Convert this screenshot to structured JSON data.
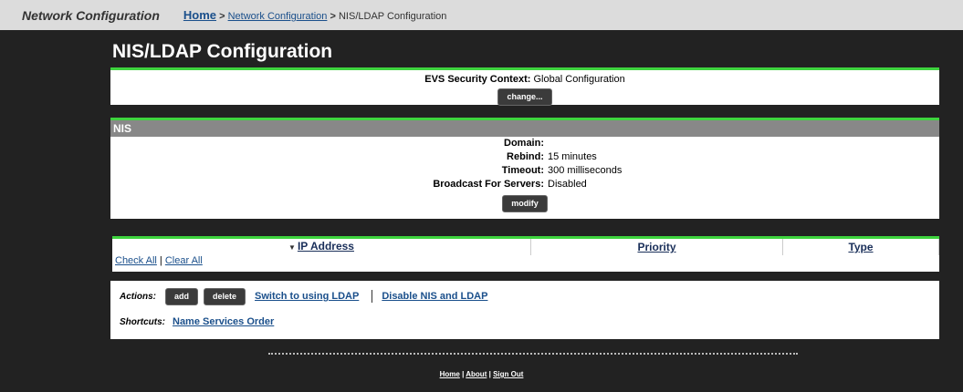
{
  "header": {
    "app_title": "Network Configuration",
    "breadcrumb": {
      "home": "Home",
      "sep1": ">",
      "network_config": "Network Configuration",
      "sep2": ">",
      "current": "NIS/LDAP Configuration"
    }
  },
  "page_title": "NIS/LDAP Configuration",
  "evs": {
    "label": "EVS Security Context:",
    "value": "Global Configuration",
    "change_button": "change..."
  },
  "nis": {
    "section_title": "NIS",
    "fields": [
      {
        "label": "Domain:",
        "value": ""
      },
      {
        "label": "Rebind:",
        "value": "15 minutes"
      },
      {
        "label": "Timeout:",
        "value": "300 milliseconds"
      },
      {
        "label": "Broadcast For Servers:",
        "value": "Disabled"
      }
    ],
    "modify_button": "modify"
  },
  "ip_table": {
    "sort_arrow": "▼",
    "columns": [
      "IP Address",
      "Priority",
      "Type"
    ],
    "check_all": "Check All",
    "divider": "|",
    "clear_all": "Clear All"
  },
  "actions": {
    "label": "Actions:",
    "add_button": "add",
    "delete_button": "delete",
    "switch_link": "Switch to using LDAP",
    "disable_link": "Disable NIS and LDAP",
    "shortcuts_label": "Shortcuts:",
    "shortcut_link": "Name Services Order"
  },
  "footer": {
    "home": "Home",
    "about": "About",
    "sign_out": "Sign Out",
    "divider": "|"
  }
}
